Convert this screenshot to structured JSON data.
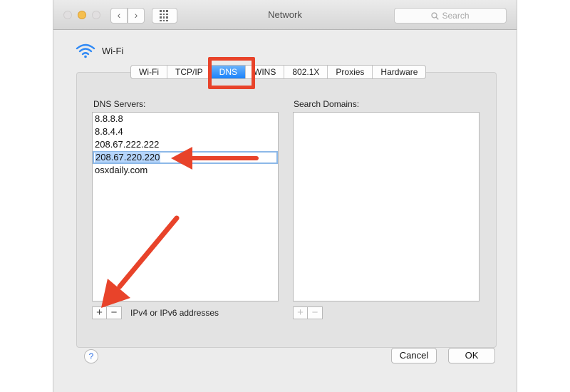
{
  "window": {
    "title": "Network"
  },
  "search": {
    "placeholder": "Search",
    "icon": "magnifier-icon"
  },
  "interface": {
    "name": "Wi-Fi",
    "icon": "wifi-icon"
  },
  "tabs": [
    {
      "label": "Wi-Fi",
      "active": false
    },
    {
      "label": "TCP/IP",
      "active": false
    },
    {
      "label": "DNS",
      "active": true
    },
    {
      "label": "WINS",
      "active": false
    },
    {
      "label": "802.1X",
      "active": false
    },
    {
      "label": "Proxies",
      "active": false
    },
    {
      "label": "Hardware",
      "active": false
    }
  ],
  "dns": {
    "label": "DNS Servers:",
    "servers": [
      "8.8.8.8",
      "8.8.4.4",
      "208.67.222.222",
      "208.67.220.220",
      "osxdaily.com"
    ],
    "selected": "208.67.220.220",
    "hint": "IPv4 or IPv6 addresses",
    "add_label": "+",
    "remove_label": "−"
  },
  "search_domains": {
    "label": "Search Domains:",
    "add_label": "+",
    "remove_label": "−"
  },
  "buttons": {
    "help": "?",
    "cancel": "Cancel",
    "ok": "OK"
  },
  "colors": {
    "accent": "#1a82fb",
    "annotation": "#e8432a",
    "traffic_min": "#f5bf4f"
  }
}
